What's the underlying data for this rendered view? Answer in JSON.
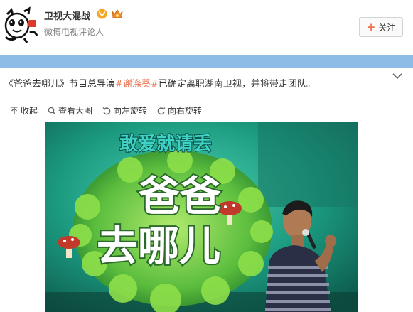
{
  "account": {
    "name": "卫视大混战",
    "description": "微博电视评论人"
  },
  "follow": {
    "label": "关注"
  },
  "post": {
    "show_name": "《爸爸去哪儿》",
    "text_mid": "节目总导演",
    "topic": "#谢涤葵#",
    "text_end": "已确定离职湖南卫视，并将带走团队。"
  },
  "toolbar": {
    "collapse": "收起",
    "view_large": "查看大图",
    "rotate_left": "向左旋转",
    "rotate_right": "向右旋转"
  },
  "photo": {
    "sign_line1": "敢爱就请丢",
    "sign_line2": "爸爸",
    "sign_line3": "去哪儿"
  },
  "colors": {
    "band": "#8dbde6",
    "topic": "#eb7350",
    "verified": "#f5a623",
    "stage_green": "#1a8c78"
  },
  "icons": [
    "verified-icon",
    "member-icon",
    "chevron-down-icon",
    "collapse-icon",
    "magnifier-icon",
    "rotate-left-icon",
    "rotate-right-icon"
  ]
}
